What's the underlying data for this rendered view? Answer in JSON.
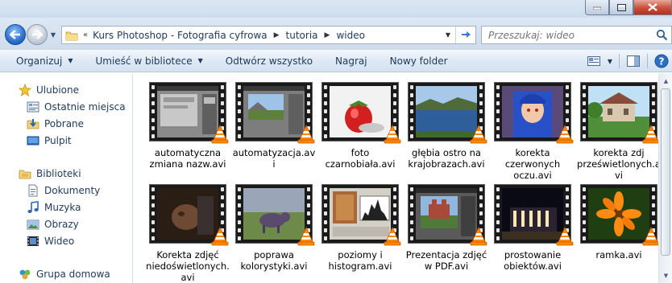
{
  "address": {
    "parts": [
      "Kurs Photoshop - Fotografia cyfrowa",
      "tutoria",
      "wideo"
    ]
  },
  "search": {
    "placeholder": "Przeszukaj: wideo"
  },
  "toolbar": {
    "organize": "Organizuj",
    "include_in_library": "Umieść w bibliotece",
    "play_all": "Odtwórz wszystko",
    "burn": "Nagraj",
    "new_folder": "Nowy folder"
  },
  "nav": {
    "favorites": "Ulubione",
    "recent": "Ostatnie miejsca",
    "downloads": "Pobrane",
    "desktop": "Pulpit",
    "libraries": "Biblioteki",
    "documents": "Dokumenty",
    "music": "Muzyka",
    "pictures": "Obrazy",
    "videos": "Wideo",
    "homegroup": "Grupa domowa"
  },
  "files": [
    {
      "name": "automatyczna zmiana nazw.avi",
      "scene": "photoshop"
    },
    {
      "name": "automatyzacja.avi",
      "scene": "landscape-ps"
    },
    {
      "name": "foto czarnobiała.avi",
      "scene": "strawberry"
    },
    {
      "name": "głębia ostro na krajobrazach.avi",
      "scene": "lake"
    },
    {
      "name": "korekta czerwonych oczu.avi",
      "scene": "child"
    },
    {
      "name": "korekta zdj prześwietlonych.avi",
      "scene": "house"
    },
    {
      "name": "Korekta zdjęć niedoświetlonych.avi",
      "scene": "dark-baby"
    },
    {
      "name": "poprawa kolorystyki.avi",
      "scene": "animal"
    },
    {
      "name": "poziomy i histogram.avi",
      "scene": "histogram"
    },
    {
      "name": "Prezentacja zdjęć w PDF.avi",
      "scene": "castle"
    },
    {
      "name": "prostowanie obiektów.avi",
      "scene": "night"
    },
    {
      "name": "ramka.avi",
      "scene": "flower"
    }
  ],
  "colors": {
    "accent": "#1e395b",
    "vlc_orange": "#ff8800"
  }
}
